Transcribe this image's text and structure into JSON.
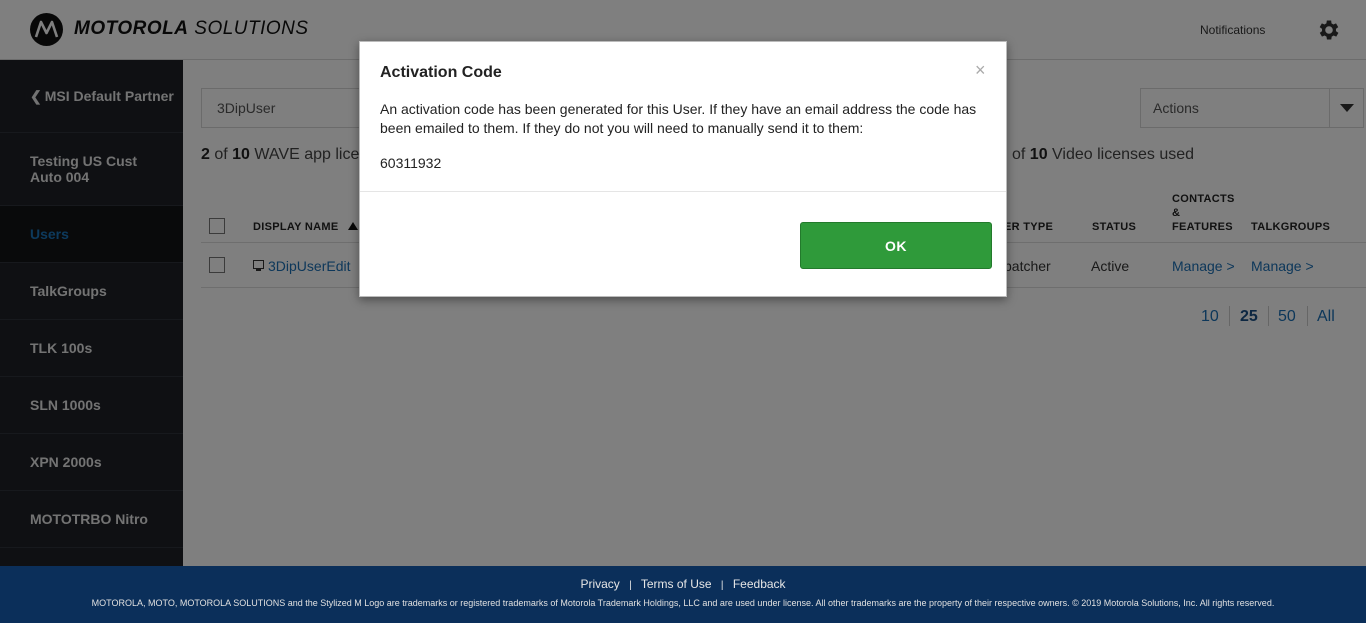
{
  "header": {
    "brand_bold": "MOTOROLA",
    "brand_light": "SOLUTIONS",
    "notifications": "Notifications"
  },
  "sidebar": {
    "items": [
      {
        "label": "MSI Default Partner",
        "back": "❮"
      },
      {
        "label": "Testing US Cust Auto 004"
      },
      {
        "label": "Users"
      },
      {
        "label": "TalkGroups"
      },
      {
        "label": "TLK 100s"
      },
      {
        "label": "SLN 1000s"
      },
      {
        "label": "XPN 2000s"
      },
      {
        "label": "MOTOTRBO Nitro"
      }
    ]
  },
  "main": {
    "search_value": "3DipUser",
    "actions_label": "Actions",
    "licenses_left": {
      "used": "2",
      "of": "of",
      "total": "10",
      "text": "WAVE app lice"
    },
    "licenses_right": {
      "of": "of",
      "total": "10",
      "text": "Video licenses used"
    },
    "columns": {
      "display_name": "DISPLAY NAME",
      "user_type": "ER TYPE",
      "status": "STATUS",
      "contacts_1": "CONTACTS",
      "contacts_2": "&",
      "contacts_3": "FEATURES",
      "talkgroups": "TALKGROUPS"
    },
    "row": {
      "name": "3DipUserEdit",
      "type": "patcher",
      "status": "Active",
      "manage1": "Manage >",
      "manage2": "Manage >"
    },
    "pager": [
      "10",
      "25",
      "50",
      "All"
    ],
    "pager_current": "25"
  },
  "footer": {
    "privacy": "Privacy",
    "terms": "Terms of Use",
    "feedback": "Feedback",
    "sep": "|",
    "legal": "MOTOROLA, MOTO, MOTOROLA SOLUTIONS and the Stylized M Logo are trademarks or registered trademarks of Motorola Trademark Holdings, LLC and are used under license. All other trademarks are the property of their respective owners. © 2019 Motorola Solutions, Inc. All rights reserved."
  },
  "modal": {
    "title": "Activation Code",
    "close": "×",
    "body": "An activation code has been generated for this User. If they have an email address the code has been emailed to them. If they do not you will need to manually send it to them:",
    "code": "60311932",
    "ok": "OK"
  },
  "colors": {
    "accent": "#1a6fb5",
    "ok_button": "#2f9a3a",
    "sidebar": "#1e2127",
    "footer": "#0b2f5a"
  }
}
